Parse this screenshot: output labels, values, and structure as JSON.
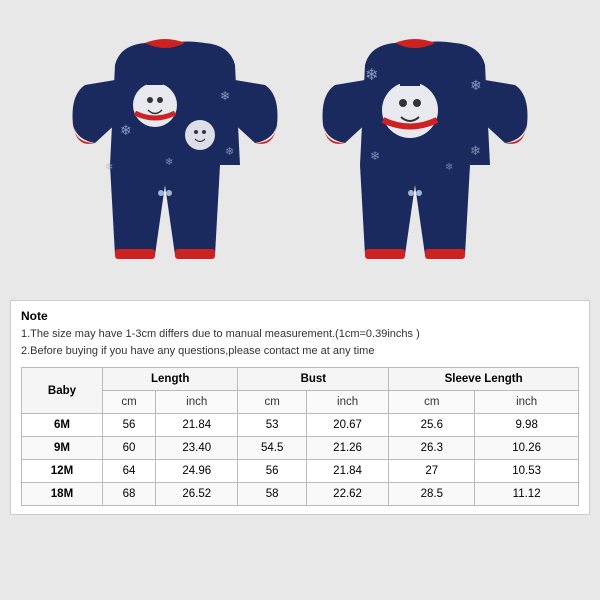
{
  "note": {
    "title": "Note",
    "line1": "1.The size may have 1-3cm differs due to manual measurement.(1cm=0.39inchs )",
    "line2": "2.Before buying if you have any questions,please contact me at any time"
  },
  "table": {
    "category_label": "Baby",
    "columns": [
      {
        "name": "Length",
        "sub": [
          "cm",
          "inch"
        ]
      },
      {
        "name": "Bust",
        "sub": [
          "cm",
          "inch"
        ]
      },
      {
        "name": "Sleeve Length",
        "sub": [
          "cm",
          "inch"
        ]
      }
    ],
    "rows": [
      {
        "size": "6M",
        "length_cm": "56",
        "length_in": "21.84",
        "bust_cm": "53",
        "bust_in": "20.67",
        "sleeve_cm": "25.6",
        "sleeve_in": "9.98"
      },
      {
        "size": "9M",
        "length_cm": "60",
        "length_in": "23.40",
        "bust_cm": "54.5",
        "bust_in": "21.26",
        "sleeve_cm": "26.3",
        "sleeve_in": "10.26"
      },
      {
        "size": "12M",
        "length_cm": "64",
        "length_in": "24.96",
        "bust_cm": "56",
        "bust_in": "21.84",
        "sleeve_cm": "27",
        "sleeve_in": "10.53"
      },
      {
        "size": "18M",
        "length_cm": "68",
        "length_in": "26.52",
        "bust_cm": "58",
        "bust_in": "22.62",
        "sleeve_cm": "28.5",
        "sleeve_in": "11.12"
      }
    ]
  }
}
